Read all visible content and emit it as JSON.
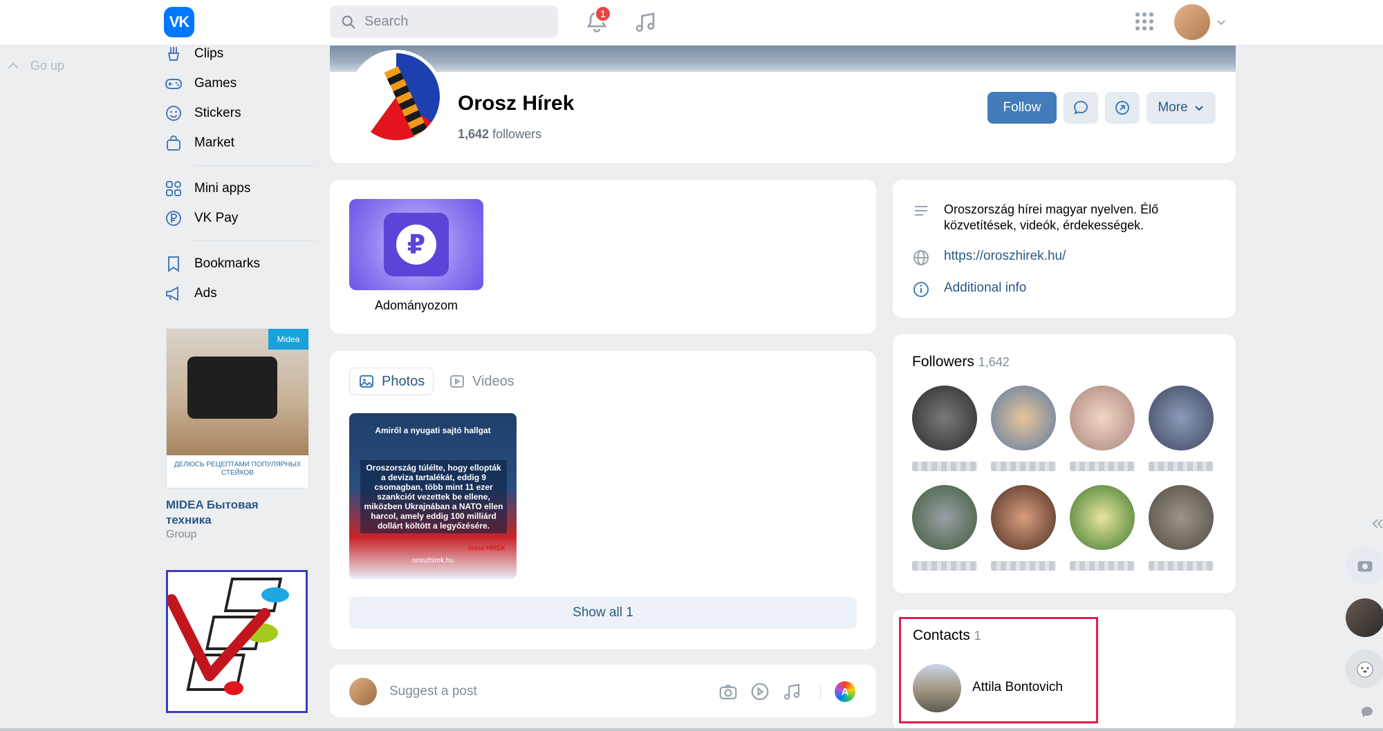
{
  "header": {
    "logo": "VK",
    "search_placeholder": "Search",
    "notifications_count": "1"
  },
  "sidebar": {
    "go_up": "Go up",
    "items": [
      {
        "label": "Clips",
        "icon": "clips-icon"
      },
      {
        "label": "Games",
        "icon": "gamepad-icon"
      },
      {
        "label": "Stickers",
        "icon": "smile-icon"
      },
      {
        "label": "Market",
        "icon": "bag-icon"
      },
      {
        "label": "Mini apps",
        "icon": "grid-icon"
      },
      {
        "label": "VK Pay",
        "icon": "ruble-icon"
      },
      {
        "label": "Bookmarks",
        "icon": "bookmark-icon"
      },
      {
        "label": "Ads",
        "icon": "megaphone-icon"
      }
    ],
    "ad": {
      "caption": "ДЕЛЮСЬ РЕЦЕПТАМИ ПОПУЛЯРНЫХ СТЕЙКОВ",
      "brand_badge": "Midea",
      "title": "MIDEA Бытовая техника",
      "subtitle": "Group"
    }
  },
  "profile": {
    "name": "Orosz Hírek",
    "followers_count": "1,642",
    "followers_label": "followers",
    "follow_label": "Follow",
    "more_label": "More"
  },
  "donate": {
    "symbol": "₽",
    "label": "Adományozom"
  },
  "media": {
    "tabs": [
      {
        "label": "Photos",
        "active": true
      },
      {
        "label": "Videos",
        "active": false
      }
    ],
    "photo": {
      "headline": "Amiről a nyugati sajtó hallgat",
      "body": "Oroszország túlélte, hogy ellopták a deviza tartalékát, eddig 9 csomagban, több mint 11 ezer szankciót vezettek be ellene, miközben Ukrajnában a NATO ellen harcol, amely eddig 100 milliárd dollárt költött a legyőzésére.",
      "brand": "orosz HÍREK",
      "site": "oroszhirek.hu"
    },
    "show_all_label": "Show all 1"
  },
  "suggest": {
    "placeholder": "Suggest a post",
    "a_icon": "A"
  },
  "about": {
    "description": "Oroszország hírei magyar nyelven. Élő közvetítések, videók, érdekességek.",
    "website": "https://oroszhirek.hu/",
    "additional": "Additional info"
  },
  "followers": {
    "title": "Followers",
    "count": "1,642"
  },
  "contacts": {
    "title": "Contacts",
    "count": "1",
    "person": "Attila Bontovich"
  },
  "colors": {
    "accent": "#447bba",
    "link": "#2a5885",
    "highlight": "#e8194f",
    "badge": "#e64646"
  }
}
